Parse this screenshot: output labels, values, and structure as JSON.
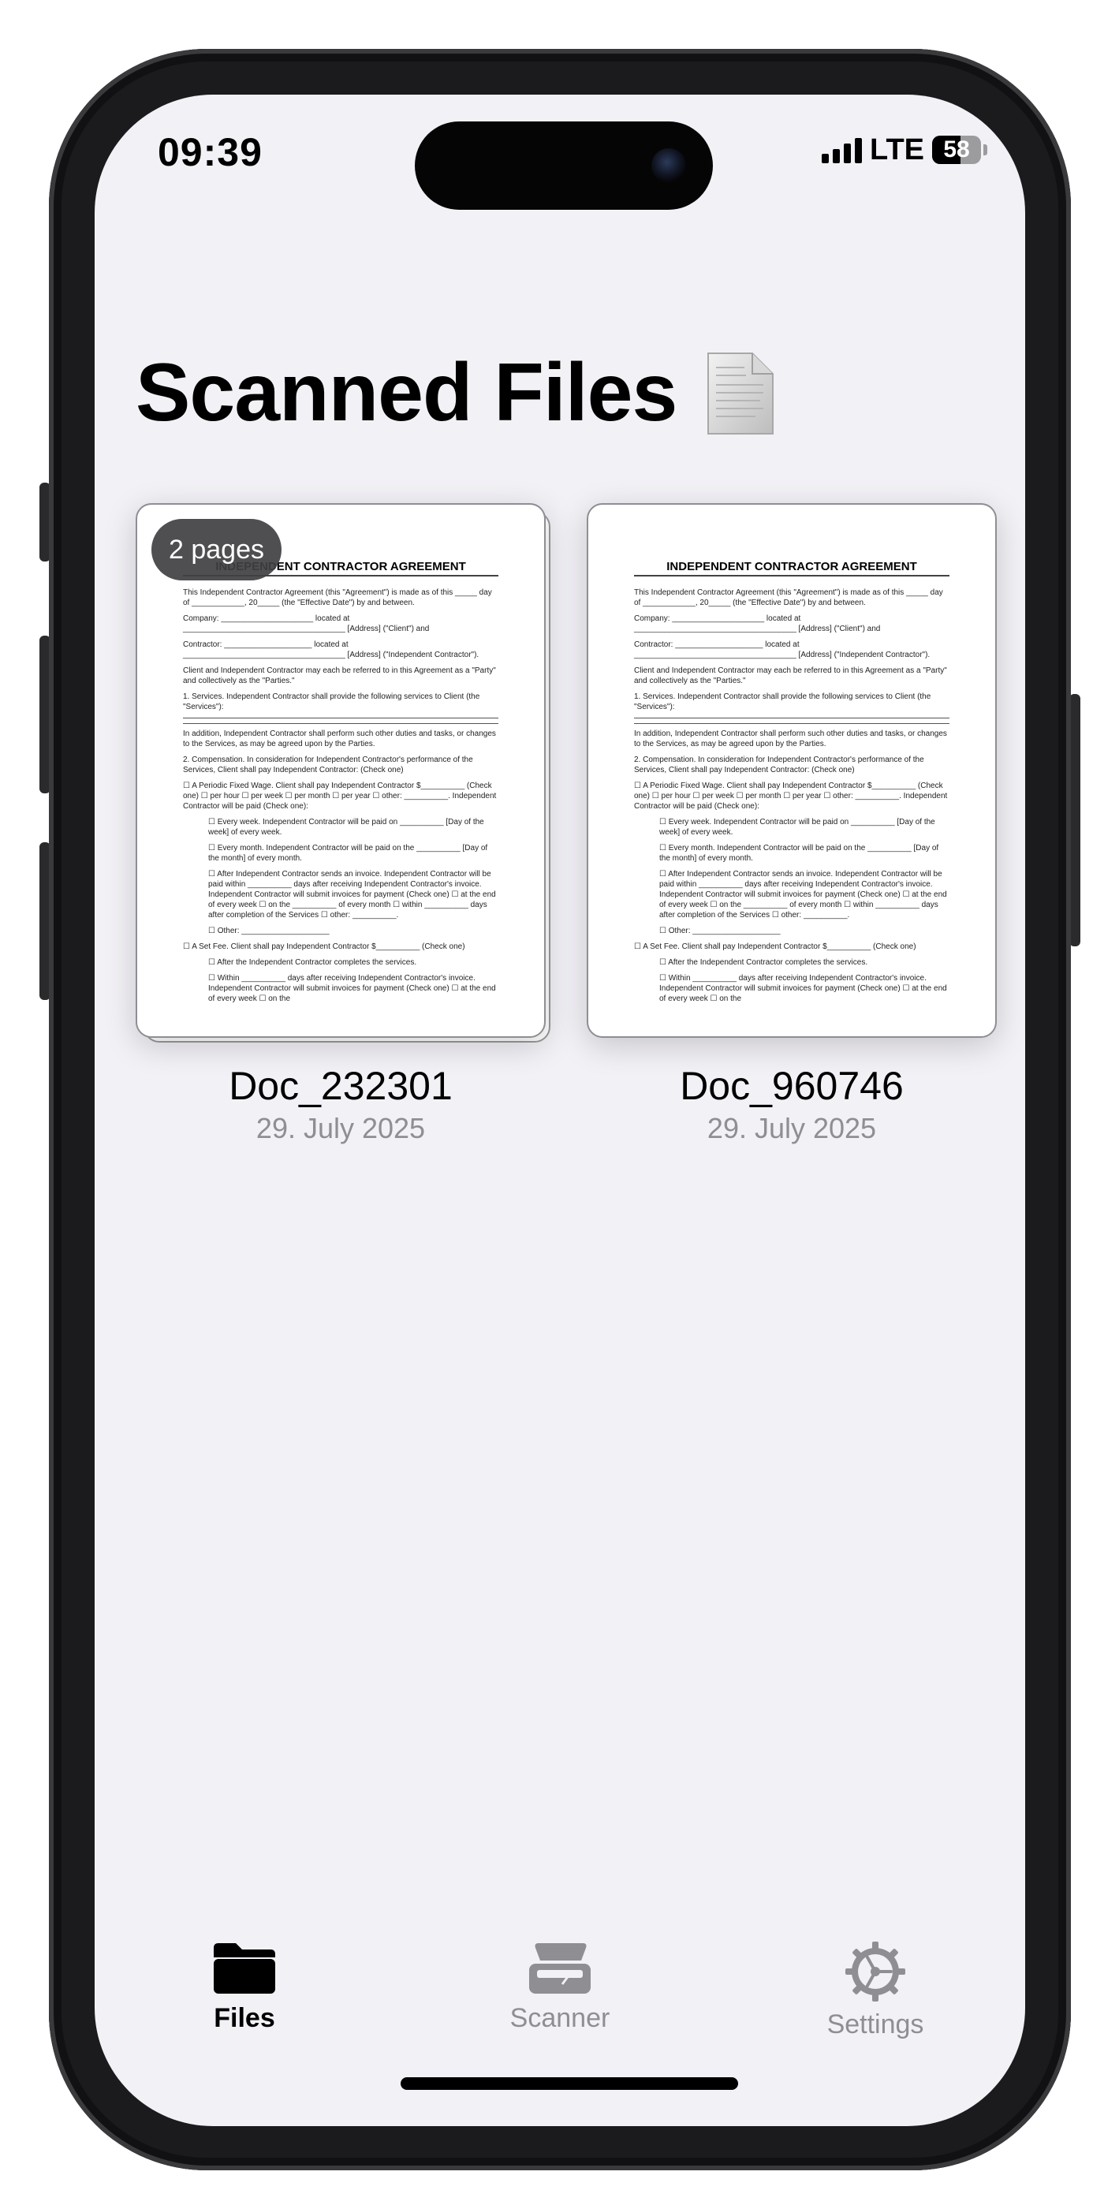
{
  "status_bar": {
    "time": "09:39",
    "network": "LTE",
    "battery": "58",
    "battery_level": 0.58
  },
  "header": {
    "title": "Scanned Files",
    "title_icon": "document-icon"
  },
  "documents": [
    {
      "name": "Doc_232301",
      "date": "29. July 2025",
      "pages_badge": "2 pages",
      "preview": {
        "title": "INDEPENDENT CONTRACTOR AGREEMENT",
        "lines": [
          "This Independent Contractor Agreement (this \"Agreement\") is made as of this _____ day of ____________, 20_____ (the \"Effective Date\") by and between.",
          "Company: _____________________ located at _____________________________________ [Address] (\"Client\") and",
          "Contractor: ____________________ located at _____________________________________ [Address] (\"Independent Contractor\").",
          "Client and Independent Contractor may each be referred to in this Agreement as a \"Party\" and collectively as the \"Parties.\"",
          "1. Services. Independent Contractor shall provide the following services to Client (the \"Services\"):",
          "In addition, Independent Contractor shall perform such other duties and tasks, or changes to the Services, as may be agreed upon by the Parties.",
          "2. Compensation. In consideration for Independent Contractor's performance of the Services, Client shall pay Independent Contractor: (Check one)",
          "☐ A Periodic Fixed Wage. Client shall pay Independent Contractor $__________ (Check one) ☐ per hour ☐ per week ☐ per month ☐ per year ☐ other: __________. Independent Contractor will be paid (Check one):",
          "☐ Every week. Independent Contractor will be paid on __________ [Day of the week] of every week.",
          "☐ Every month. Independent Contractor will be paid on the __________ [Day of the month] of every month.",
          "☐ After Independent Contractor sends an invoice. Independent Contractor will be paid within __________ days after receiving Independent Contractor's invoice. Independent Contractor will submit invoices for payment (Check one) ☐ at the end of every week ☐ on the __________ of every month ☐ within __________ days after completion of the Services ☐ other: __________.",
          "☐ Other: ____________________",
          "☐ A Set Fee. Client shall pay Independent Contractor $__________ (Check one)",
          "☐ After the Independent Contractor completes the services.",
          "☐ Within __________ days after receiving Independent Contractor's invoice. Independent Contractor will submit invoices for payment (Check one) ☐ at the end of every week ☐ on the"
        ]
      }
    },
    {
      "name": "Doc_960746",
      "date": "29. July 2025",
      "pages_badge": "",
      "preview": {
        "title": "INDEPENDENT CONTRACTOR AGREEMENT",
        "lines": [
          "This Independent Contractor Agreement (this \"Agreement\") is made as of this _____ day of ____________, 20_____ (the \"Effective Date\") by and between.",
          "Company: _____________________ located at _____________________________________ [Address] (\"Client\") and",
          "Contractor: ____________________ located at _____________________________________ [Address] (\"Independent Contractor\").",
          "Client and Independent Contractor may each be referred to in this Agreement as a \"Party\" and collectively as the \"Parties.\"",
          "1. Services. Independent Contractor shall provide the following services to Client (the \"Services\"):",
          "In addition, Independent Contractor shall perform such other duties and tasks, or changes to the Services, as may be agreed upon by the Parties.",
          "2. Compensation. In consideration for Independent Contractor's performance of the Services, Client shall pay Independent Contractor: (Check one)",
          "☐ A Periodic Fixed Wage. Client shall pay Independent Contractor $__________ (Check one) ☐ per hour ☐ per week ☐ per month ☐ per year ☐ other: __________. Independent Contractor will be paid (Check one):",
          "☐ Every week. Independent Contractor will be paid on __________ [Day of the week] of every week.",
          "☐ Every month. Independent Contractor will be paid on the __________ [Day of the month] of every month.",
          "☐ After Independent Contractor sends an invoice. Independent Contractor will be paid within __________ days after receiving Independent Contractor's invoice. Independent Contractor will submit invoices for payment (Check one) ☐ at the end of every week ☐ on the __________ of every month ☐ within __________ days after completion of the Services ☐ other: __________.",
          "☐ Other: ____________________",
          "☐ A Set Fee. Client shall pay Independent Contractor $__________ (Check one)",
          "☐ After the Independent Contractor completes the services.",
          "☐ Within __________ days after receiving Independent Contractor's invoice. Independent Contractor will submit invoices for payment (Check one) ☐ at the end of every week ☐ on the"
        ]
      }
    }
  ],
  "tabbar": {
    "tabs": [
      {
        "label": "Files",
        "icon": "folder-icon",
        "active": true
      },
      {
        "label": "Scanner",
        "icon": "scanner-icon",
        "active": false
      },
      {
        "label": "Settings",
        "icon": "gear-icon",
        "active": false
      }
    ]
  },
  "colors": {
    "background": "#f2f1f6",
    "inactive_tab": "#8e8e93",
    "active_tab": "#000000"
  }
}
